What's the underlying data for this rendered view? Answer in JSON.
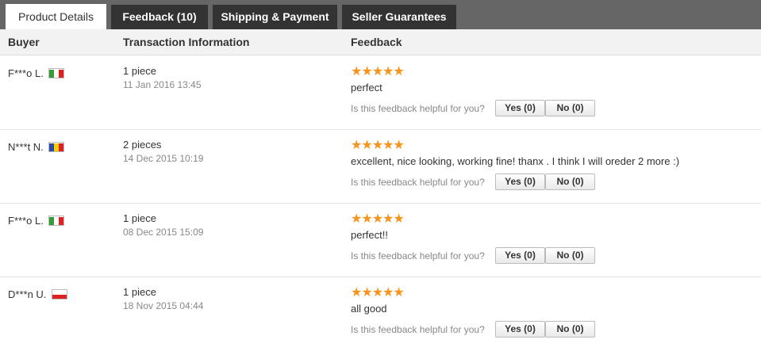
{
  "tabs": [
    {
      "label": "Product Details"
    },
    {
      "label": "Feedback (10)"
    },
    {
      "label": "Shipping & Payment"
    },
    {
      "label": "Seller Guarantees"
    }
  ],
  "header": {
    "buyer": "Buyer",
    "transaction": "Transaction Information",
    "feedback": "Feedback"
  },
  "reviews": [
    {
      "buyer": "F***o L.",
      "country": "Italy",
      "quantity": "1 piece",
      "date": "11 Jan 2016 13:45",
      "stars": "★★★★★",
      "text": "perfect",
      "helpful_question": "Is this feedback helpful for you?",
      "yes_label": "Yes (0)",
      "no_label": "No (0)"
    },
    {
      "buyer": "N***t N.",
      "country": "Romania",
      "quantity": "2 pieces",
      "date": "14 Dec 2015 10:19",
      "stars": "★★★★★",
      "text": "excellent, nice looking, working fine! thanx . I think I will oreder 2 more :)",
      "helpful_question": "Is this feedback helpful for you?",
      "yes_label": "Yes (0)",
      "no_label": "No (0)"
    },
    {
      "buyer": "F***o L.",
      "country": "Italy",
      "quantity": "1 piece",
      "date": "08 Dec 2015 15:09",
      "stars": "★★★★★",
      "text": "perfect!!",
      "helpful_question": "Is this feedback helpful for you?",
      "yes_label": "Yes (0)",
      "no_label": "No (0)"
    },
    {
      "buyer": "D***n U.",
      "country": "Poland",
      "quantity": "1 piece",
      "date": "18 Nov 2015 04:44",
      "stars": "★★★★★",
      "text": "all good",
      "helpful_question": "Is this feedback helpful for you?",
      "yes_label": "Yes (0)",
      "no_label": "No (0)"
    }
  ],
  "colors": {
    "star": "#f7941d",
    "tabbar": "#666666",
    "tab": "#333333"
  }
}
